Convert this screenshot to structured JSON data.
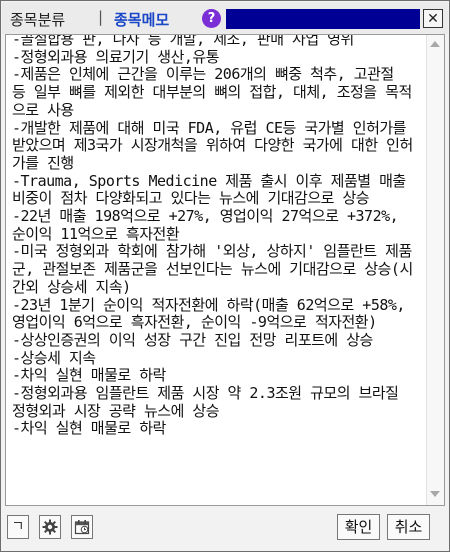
{
  "title_bar": {
    "tab_category": "종목분류",
    "separator": "|",
    "tab_memo": "종목메모",
    "help_label": "?",
    "close_label": "✕"
  },
  "memo": {
    "text": "-골절합용 판, 나사 등 개발, 제조, 판매 사업 영위\n-정형외과용 의료기기 생산,유통\n-제품은 인체에 근간을 이루는 206개의 뼈중 척추, 고관절 등 일부 뼈를 제외한 대부분의 뼈의 접합, 대체, 조정을 목적으로 사용\n-개발한 제품에 대해 미국 FDA, 유럽 CE등 국가별 인허가를 받았으며 제3국가 시장개척을 위하여 다양한 국가에 대한 인허가를 진행\n-Trauma, Sports Medicine 제품 출시 이후 제품별 매출 비중이 점차 다양화되고 있다는 뉴스에 기대감으로 상승\n-22년 매출 198억으로 +27%, 영업이익 27억으로 +372%, 순이익 11억으로 흑자전환\n-미국 정형외과 학회에 참가해 '외상, 상하지' 임플란트 제품군, 관절보존 제품군을 선보인다는 뉴스에 기대감으로 상승(시간외 상승세 지속)\n-23년 1분기 순이익 적자전환에 하락(매출 62억으로 +58%, 영업이익 6억으로 흑자전환, 순이익 -9억으로 적자전환)\n-상상인증권의 이익 성장 구간 진입 전망 리포트에 상승\n-상승세 지속\n-차익 실현 매물로 하락\n-정형외과용 임플란트 제품 시장 약 2.3조원 규모의 브라질 정형외과 시장 공략 뉴스에 상승\n-차익 실현 매물로 하락"
  },
  "toolbar": {
    "hangul_label": "ㄱ",
    "confirm_label": "확인",
    "cancel_label": "취소"
  },
  "icons": [
    "gear-icon",
    "calendar-icon",
    "chevron-up-icon",
    "chevron-down-icon",
    "close-icon",
    "help-icon"
  ],
  "colors": {
    "memo_tab": "#1a47c8",
    "help": "#7a2fd6",
    "selection": "#000095"
  }
}
